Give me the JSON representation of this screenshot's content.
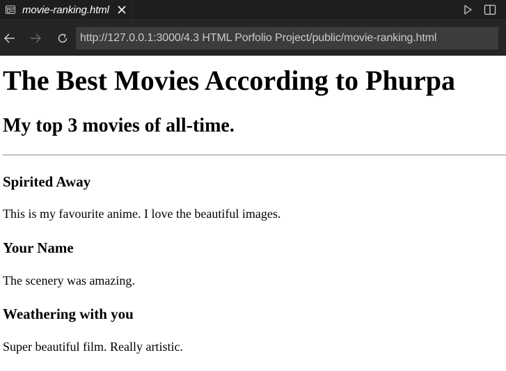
{
  "editor": {
    "tab_title": "movie-ranking.html",
    "tab_icon": "preview-icon",
    "close_icon": "close-icon",
    "actions": [
      "run-icon",
      "split-editor-icon"
    ],
    "background": "#1e1e1e"
  },
  "browser": {
    "back_icon": "arrow-left-icon",
    "forward_icon": "arrow-right-icon",
    "reload_icon": "reload-icon",
    "url": "http://127.0.0.1:3000/4.3 HTML Porfolio Project/public/movie-ranking.html"
  },
  "page": {
    "title": "The Best Movies According to Phurpa",
    "subtitle": "My top 3 movies of all-time.",
    "movies": [
      {
        "name": "Spirited Away",
        "description": "This is my favourite anime. I love the beautiful images."
      },
      {
        "name": "Your Name",
        "description": "The scenery was amazing."
      },
      {
        "name": "Weathering with you",
        "description": "Super beautiful film. Really artistic."
      }
    ]
  }
}
